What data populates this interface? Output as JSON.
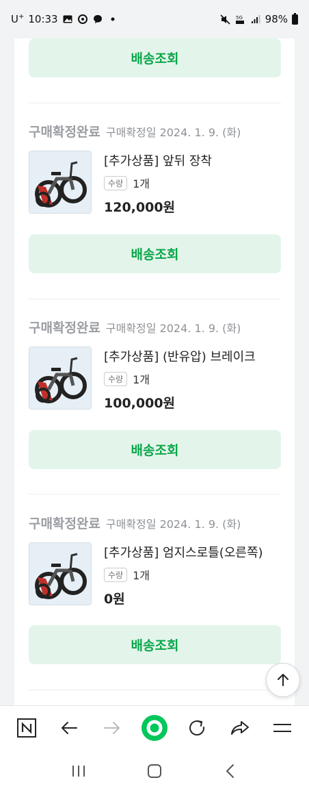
{
  "status_bar": {
    "time": "10:33",
    "carrier": "U",
    "carrier_sup": "+",
    "battery": "98%"
  },
  "track_label": "배송조회",
  "orders": [
    {
      "status": "구매확정완료",
      "date": "구매확정일 2024. 1. 9. (화)",
      "product": "[추가상품] 앞뒤 장착",
      "qty_label": "수량",
      "qty": "1개",
      "price": "120,000원"
    },
    {
      "status": "구매확정완료",
      "date": "구매확정일 2024. 1. 9. (화)",
      "product": "[추가상품] (반유압) 브레이크",
      "qty_label": "수량",
      "qty": "1개",
      "price": "100,000원"
    },
    {
      "status": "구매확정완료",
      "date": "구매확정일 2024. 1. 9. (화)",
      "product": "[추가상품] 엄지스로틀(오른쪽)",
      "qty_label": "수량",
      "qty": "1개",
      "price": "0원"
    }
  ],
  "colors": {
    "accent_green": "#0aa64a",
    "track_button_bg": "#e3f5ea",
    "naver_green": "#03c75a"
  },
  "icons": {
    "scroll_top": "arrow-up-icon",
    "toolbar": [
      "naver-n-icon",
      "back-arrow-icon",
      "forward-arrow-icon",
      "naver-home-icon",
      "refresh-icon",
      "share-icon",
      "menu-icon"
    ],
    "navbar": [
      "recent-apps-icon",
      "home-icon",
      "back-icon"
    ]
  }
}
